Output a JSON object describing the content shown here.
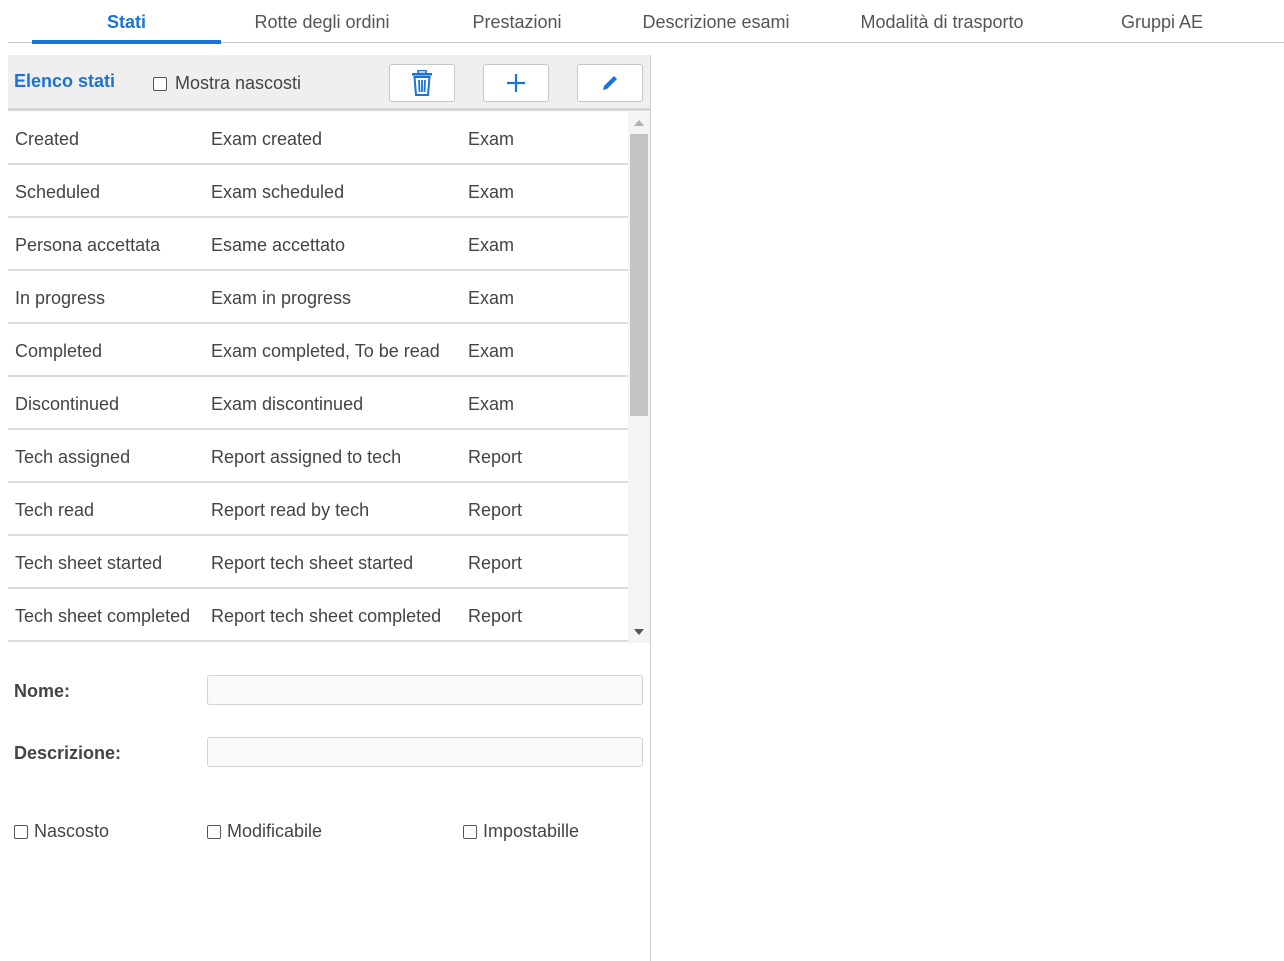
{
  "tabs": [
    {
      "label": "Stati",
      "active": true
    },
    {
      "label": "Rotte degli ordini",
      "active": false
    },
    {
      "label": "Prestazioni",
      "active": false
    },
    {
      "label": "Descrizione esami",
      "active": false
    },
    {
      "label": "Modalità di trasporto",
      "active": false
    },
    {
      "label": "Gruppi AE",
      "active": false
    }
  ],
  "toolbar": {
    "title": "Elenco stati",
    "show_hidden_label": "Mostra nascosti",
    "buttons": {
      "delete": "trash-icon",
      "add": "plus-icon",
      "edit": "pencil-icon"
    }
  },
  "states": [
    {
      "name": "Created",
      "description": "Exam created",
      "type": "Exam"
    },
    {
      "name": "Scheduled",
      "description": "Exam scheduled",
      "type": "Exam"
    },
    {
      "name": "Persona accettata",
      "description": "Esame accettato",
      "type": "Exam"
    },
    {
      "name": "In progress",
      "description": "Exam in progress",
      "type": "Exam"
    },
    {
      "name": "Completed",
      "description": "Exam completed, To be read",
      "type": "Exam"
    },
    {
      "name": "Discontinued",
      "description": "Exam discontinued",
      "type": "Exam"
    },
    {
      "name": "Tech assigned",
      "description": "Report assigned to tech",
      "type": "Report"
    },
    {
      "name": "Tech read",
      "description": "Report read by tech",
      "type": "Report"
    },
    {
      "name": "Tech sheet started",
      "description": "Report tech sheet started",
      "type": "Report"
    },
    {
      "name": "Tech sheet completed",
      "description": "Report tech sheet completed",
      "type": "Report"
    }
  ],
  "form": {
    "name_label": "Nome:",
    "name_value": "",
    "description_label": "Descrizione:",
    "description_value": "",
    "hidden_label": "Nascosto",
    "editable_label": "Modificabile",
    "settable_label": "Impostabille"
  },
  "colors": {
    "accent": "#1a73d9"
  }
}
